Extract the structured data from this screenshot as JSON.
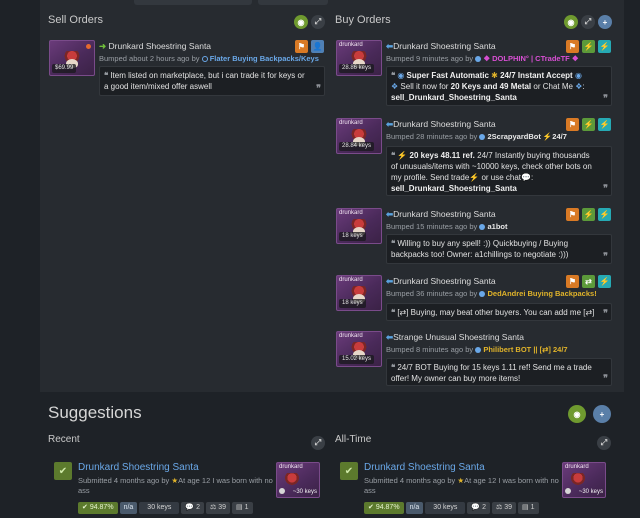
{
  "sell": {
    "title": "Sell Orders",
    "orders": [
      {
        "item": "Drunkard Shoestring Santa",
        "price": "$69.99",
        "bumped": "Bumped about 2 hours ago by",
        "user": "Flater Buying Backpacks/Keys",
        "message": "Item listed on marketplace, but i can trade it for keys or a good item/mixed offer aswell"
      }
    ]
  },
  "buy": {
    "title": "Buy Orders",
    "orders": [
      {
        "item": "Drunkard Shoestring Santa",
        "thumb_name": "drunkard",
        "price": "28.86 keys",
        "bumped": "Bumped 9 minutes ago by",
        "user": "❖ DOLPHIN° | CTradeTF ❖",
        "line1": "Super Fast Automatic",
        "line1b": "24/7 Instant Accept",
        "line2a": "Sell it now for",
        "line2b": "20 Keys and 49 Metal",
        "line2c": "or Chat Me",
        "line3": "sell_Drunkard_Shoestring_Santa"
      },
      {
        "item": "Drunkard Shoestring Santa",
        "thumb_name": "drunkard",
        "price": "28.84 keys",
        "bumped": "Bumped 28 minutes ago by",
        "user": "2ScrapyardBot ⚡24/7",
        "lead": "⚡ 20 keys 48.11 ref.",
        "message": "24/7 Instantly buying thousands of unusuals/items with ~10000 keys, check other bots on my profile. Send  trade⚡ or  use  chat💬:",
        "cmd": "sell_Drunkard_Shoestring_Santa"
      },
      {
        "item": "Drunkard Shoestring Santa",
        "thumb_name": "drunkard",
        "price": "18 keys",
        "bumped": "Bumped 15 minutes ago by",
        "user": "a1bot",
        "message": "Willing to buy any spell! :)) Quickbuying / Buying backpacks too!        Owner: a1chillings          to negotiate :)))"
      },
      {
        "item": "Drunkard Shoestring Santa",
        "thumb_name": "drunkard",
        "price": "18 keys",
        "bumped": "Bumped 36 minutes ago by",
        "user": "DedAndrei Buying Backpacks!",
        "message": "[⇄] Buying, may beat other buyers. You can add me [⇄]"
      },
      {
        "item": "Strange Unusual Shoestring Santa",
        "thumb_name": "drunkard",
        "price": "15.02 keys",
        "bumped": "Bumped 8 minutes ago by",
        "user": "Philibert BOT || [⇄] 24/7",
        "message": "24/7 BOT Buying for 15 keys 1.11 ref! Send me a trade offer! My owner can buy more items!"
      }
    ]
  },
  "suggestions": {
    "title": "Suggestions",
    "recent": {
      "title": "Recent",
      "item": "Drunkard Shoestring Santa",
      "meta1": "Submitted 4 months ago by",
      "author": "At age 12 I was born with no ass",
      "pct": "94.87%",
      "na": "n/a",
      "keys": "30 keys",
      "comments": "2",
      "votes": "39",
      "files": "1",
      "thumb_name": "drunkard",
      "thumb_keys": "~30 keys"
    },
    "alltime": {
      "title": "All-Time",
      "item": "Drunkard Shoestring Santa",
      "meta1": "Submitted 4 months ago by",
      "author": "At age 12 I was born with no ass",
      "pct": "94.87%",
      "na": "n/a",
      "keys": "30 keys",
      "comments": "2",
      "votes": "39",
      "files": "1",
      "thumb_name": "drunkard",
      "thumb_keys": "~30 keys"
    }
  }
}
